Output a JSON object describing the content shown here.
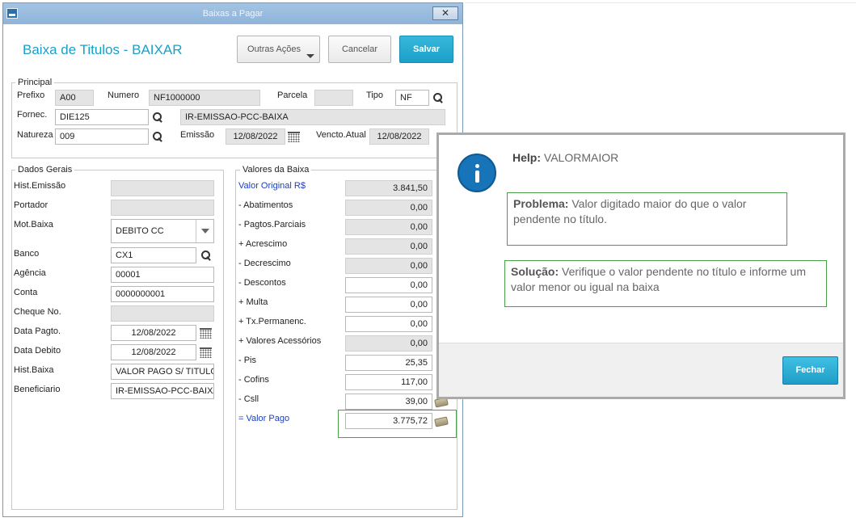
{
  "window": {
    "title": "Baixas a Pagar",
    "close_label": "✕"
  },
  "header": {
    "title": "Baixa de Titulos - BAIXAR",
    "outras_acoes": "Outras Ações",
    "cancelar": "Cancelar",
    "salvar": "Salvar"
  },
  "principal": {
    "legend": "Principal",
    "prefixo_label": "Prefixo",
    "prefixo": "A00",
    "numero_label": "Numero",
    "numero": "NF1000000",
    "parcela_label": "Parcela",
    "parcela": "",
    "tipo_label": "Tipo",
    "tipo": "NF",
    "fornec_label": "Fornec.",
    "fornec": "DIE125",
    "fornec_nome": "IR-EMISSAO-PCC-BAIXA",
    "natureza_label": "Natureza",
    "natureza": "009",
    "emissao_label": "Emissão",
    "emissao": "12/08/2022",
    "vencto_label": "Vencto.Atual",
    "vencto": "12/08/2022"
  },
  "dados_gerais": {
    "legend": "Dados Gerais",
    "hist_emissao_label": "Hist.Emissão",
    "hist_emissao": "",
    "portador_label": "Portador",
    "portador": "",
    "mot_baixa_label": "Mot.Baixa",
    "mot_baixa": "DEBITO CC",
    "banco_label": "Banco",
    "banco": "CX1",
    "agencia_label": "Agência",
    "agencia": "00001",
    "conta_label": "Conta",
    "conta": "0000000001",
    "cheque_label": "Cheque No.",
    "cheque": "",
    "data_pagto_label": "Data Pagto.",
    "data_pagto": "12/08/2022",
    "data_debito_label": "Data Debito",
    "data_debito": "12/08/2022",
    "hist_baixa_label": "Hist.Baixa",
    "hist_baixa": "VALOR PAGO S/ TITULO",
    "beneficiario_label": "Beneficiario",
    "beneficiario": "IR-EMISSAO-PCC-BAIXA"
  },
  "valores": {
    "legend": "Valores da Baixa",
    "rows": [
      {
        "label": "Valor Original R$",
        "value": "3.841,50"
      },
      {
        "label": "- Abatimentos",
        "value": "0,00"
      },
      {
        "label": "- Pagtos.Parciais",
        "value": "0,00"
      },
      {
        "label": "+ Acrescimo",
        "value": "0,00"
      },
      {
        "label": "- Decrescimo",
        "value": "0,00"
      },
      {
        "label": "- Descontos",
        "value": "0,00"
      },
      {
        "label": "+ Multa",
        "value": "0,00"
      },
      {
        "label": "+ Tx.Permanenc.",
        "value": "0,00"
      },
      {
        "label": "+ Valores Acessórios",
        "value": "0,00"
      },
      {
        "label": "- Pis",
        "value": "25,35"
      },
      {
        "label": "- Cofins",
        "value": "117,00"
      },
      {
        "label": "- Csll",
        "value": "39,00"
      },
      {
        "label": "= Valor Pago",
        "value": "3.775,72"
      }
    ]
  },
  "help": {
    "title_bold": "Help:",
    "title_text": "VALORMAIOR",
    "problema_bold": "Problema:",
    "problema_text": "Valor digitado maior do que o valor pendente no título.",
    "solucao_bold": "Solução:",
    "solucao_text": "Verifique o valor pendente no título e informe um valor menor ou igual na baixa",
    "fechar": "Fechar"
  },
  "colors": {
    "accent": "#1aa0c8",
    "highlight_border": "#49a049",
    "label_blue": "#1a3fc0"
  }
}
